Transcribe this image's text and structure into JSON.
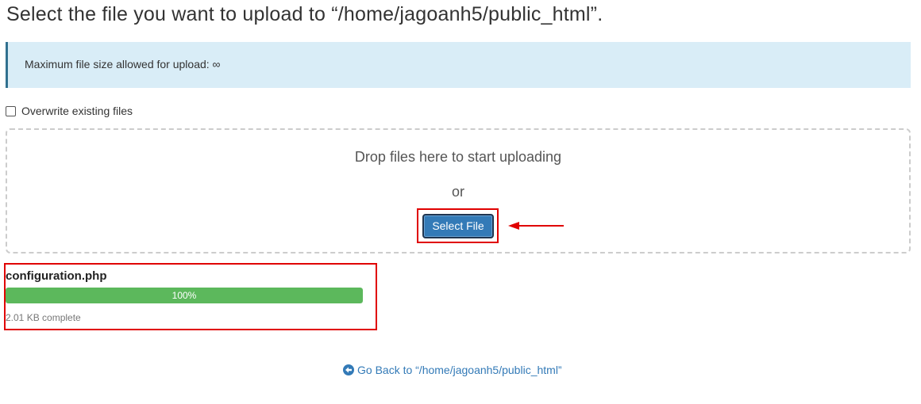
{
  "header": {
    "title": "Select the file you want to upload to “/home/jagoanh5/public_html”."
  },
  "info": {
    "max_size_text": "Maximum file size allowed for upload: ∞"
  },
  "options": {
    "overwrite_label": "Overwrite existing files",
    "overwrite_checked": false
  },
  "dropzone": {
    "drop_text": "Drop files here to start uploading",
    "or_text": "or",
    "select_button_label": "Select File"
  },
  "upload": {
    "file_name": "configuration.php",
    "progress_percent": 100,
    "progress_label": "100%",
    "status_text": "2.01 KB complete"
  },
  "footer": {
    "go_back_label": "Go Back to “/home/jagoanh5/public_html”",
    "go_back_icon": "arrow-circle-left-icon"
  },
  "colors": {
    "primary": "#337ab7",
    "success": "#5cb85c",
    "info_bg": "#d9edf7",
    "highlight": "#e00000"
  }
}
